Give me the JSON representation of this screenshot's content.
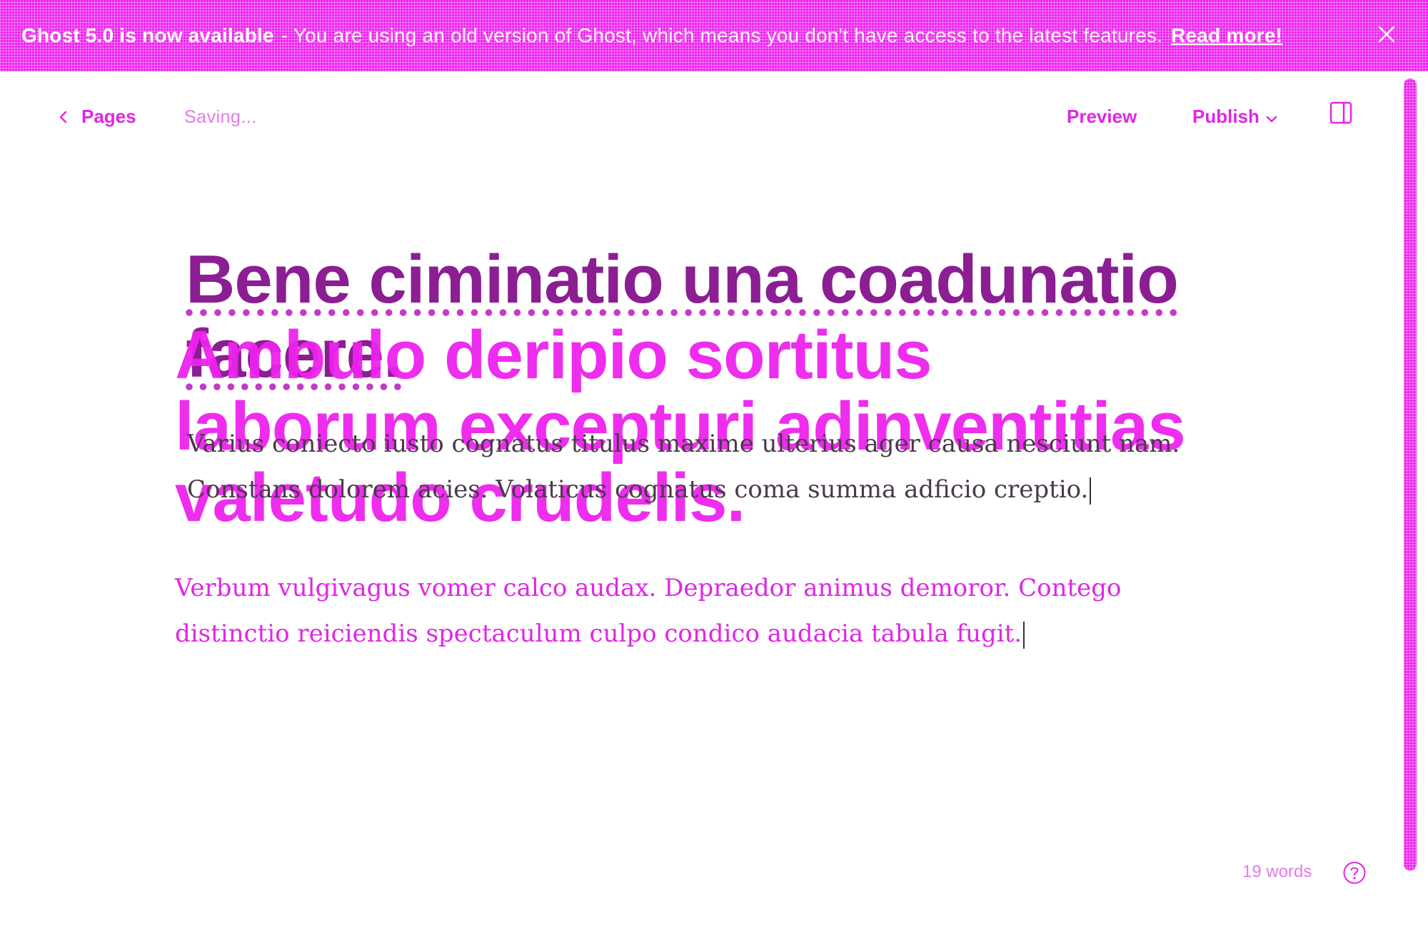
{
  "banner": {
    "strong_text": "Ghost 5.0 is now available",
    "message": "- You are using an old version of Ghost, which means you don't have access to the latest features.",
    "link_text": "Read more!",
    "close_icon": "close-icon"
  },
  "header": {
    "back_label": "Pages",
    "status": "Saving...",
    "preview_label": "Preview",
    "publish_label": "Publish",
    "settings_icon": "panel-toggle-icon"
  },
  "editor": {
    "title": "Bene ciminatio una coadunatio facere.",
    "title_ghost": "Ambulo deripio sortitus laborum excepturi adinventitias valetudo crudelis.",
    "paragraph_ghost": "Varius coniecto iusto cognatus titulus maxime ulterius ager causa nesciunt nam. Constans dolorem acies. Volaticus cognatus coma summa adficio creptio.",
    "paragraph": "Verbum vulgivagus vomer calco audax. Depraedor animus demoror. Contego distinctio reiciendis spectaculum culpo condico audacia tabula fugit."
  },
  "footer": {
    "word_count": "19 words",
    "help_icon": "help-icon"
  },
  "colors": {
    "accent": "#e026e6",
    "title": "#8a1e92",
    "banner": "#ee22ee"
  }
}
